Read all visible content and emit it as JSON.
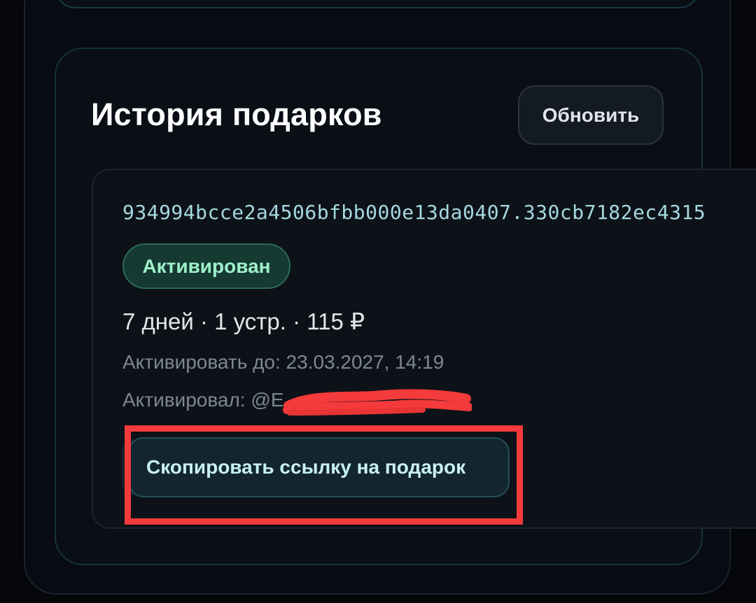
{
  "history": {
    "title": "История подарков",
    "refresh_label": "Обновить"
  },
  "gift": {
    "code": "934994bcce2a4506bfbb000e13da0407.330cb7182ec4315",
    "status": "Активирован",
    "summary": "7 дней · 1 устр. · 115 ₽",
    "expire_label": "Активировать до: 23.03.2027, 14:19",
    "activated_by_label": "Активировал: @E",
    "copy_link_label": "Скопировать ссылку на подарок"
  },
  "colors": {
    "accent": "#a6d8e0",
    "status_green": "#9ff0cc",
    "highlight_red": "#f43a3a"
  },
  "icons": {
    "redaction": "redaction-scribble"
  }
}
